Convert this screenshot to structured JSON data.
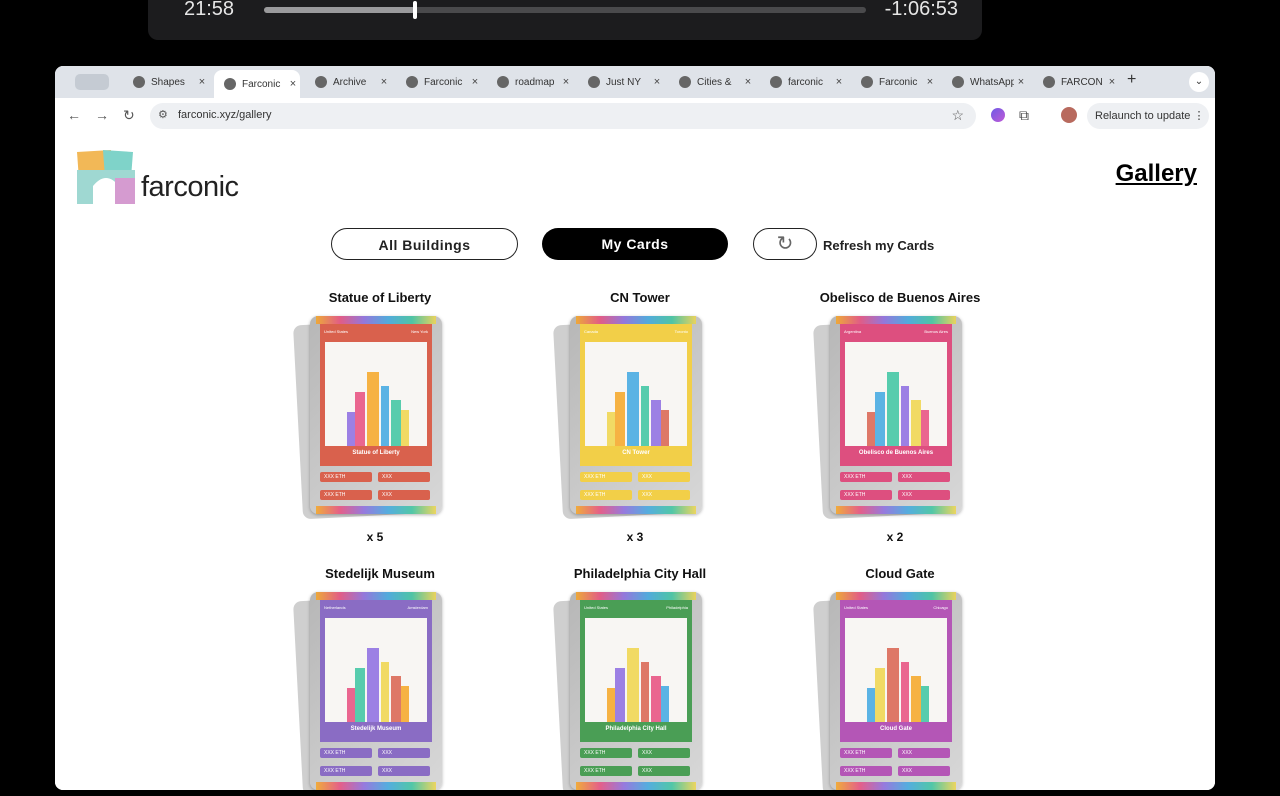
{
  "player": {
    "elapsed": "21:58",
    "remaining": "-1:06:53",
    "progress_fraction": 0.25
  },
  "browser": {
    "tabs": [
      {
        "label": "Shapes",
        "active": false
      },
      {
        "label": "Farconic",
        "active": true
      },
      {
        "label": "Archive",
        "active": false
      },
      {
        "label": "Farconic",
        "active": false
      },
      {
        "label": "roadmap",
        "active": false
      },
      {
        "label": "Just NY",
        "active": false
      },
      {
        "label": "Cities &",
        "active": false
      },
      {
        "label": "farconic",
        "active": false
      },
      {
        "label": "Farconic",
        "active": false
      },
      {
        "label": "WhatsApp",
        "active": false
      },
      {
        "label": "FARCON",
        "active": false
      }
    ],
    "url": "farconic.xyz/gallery",
    "relaunch_label": "Relaunch to update"
  },
  "header": {
    "brand": "farconic",
    "gallery_link": "Gallery"
  },
  "filters": {
    "all_buildings": "All Buildings",
    "my_cards": "My Cards",
    "refresh_label": "Refresh my Cards"
  },
  "cards": [
    {
      "title": "Statue of Liberty",
      "country": "United States",
      "city": "New York",
      "card_name": "Statue of Liberty",
      "count": "x 5",
      "theme_color": "#d9614d",
      "price": "XXX ETH",
      "other": "XXX"
    },
    {
      "title": "CN Tower",
      "country": "Canada",
      "city": "Toronto",
      "card_name": "CN Tower",
      "count": "x 3",
      "theme_color": "#f2cf48",
      "price": "XXX ETH",
      "other": "XXX"
    },
    {
      "title": "Obelisco de Buenos Aires",
      "country": "Argentina",
      "city": "Buenos Aires",
      "card_name": "Obelisco de Buenos Aires",
      "count": "x 2",
      "theme_color": "#dd4f7f",
      "price": "XXX ETH",
      "other": "XXX"
    },
    {
      "title": "Stedelijk Museum",
      "country": "Netherlands",
      "city": "Amsterdam",
      "card_name": "Stedelijk Museum",
      "count": "",
      "theme_color": "#8a6cc4",
      "price": "XXX ETH",
      "other": "XXX"
    },
    {
      "title": "Philadelphia City Hall",
      "country": "United States",
      "city": "Philadelphia",
      "card_name": "Philadelphia City Hall",
      "count": "",
      "theme_color": "#4a9e55",
      "price": "XXX ETH",
      "other": "XXX"
    },
    {
      "title": "Cloud Gate",
      "country": "United States",
      "city": "Chicago",
      "card_name": "Cloud Gate",
      "count": "",
      "theme_color": "#b456b6",
      "price": "XXX ETH",
      "other": "XXX"
    }
  ]
}
